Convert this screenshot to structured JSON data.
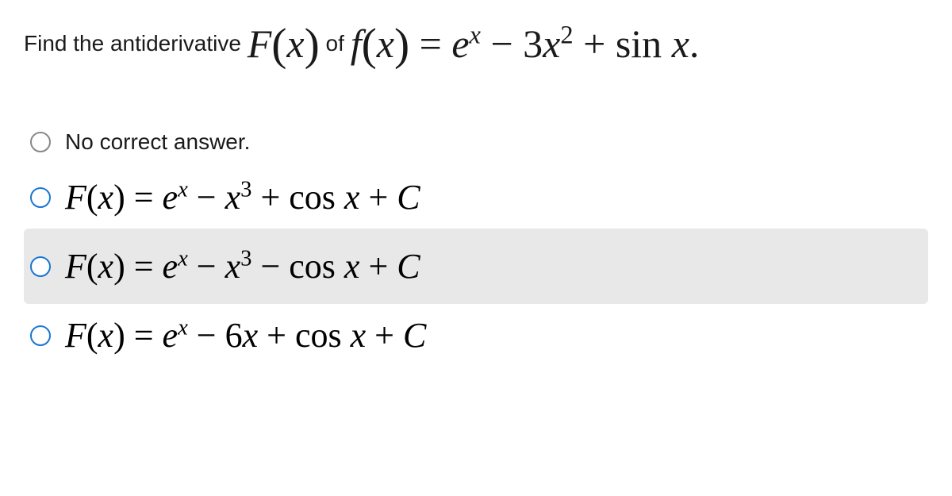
{
  "question": {
    "prefix": "Find the antiderivative ",
    "F_of_x": "F(x)",
    "middle": " of ",
    "f_of_x": "f(x) = e",
    "sup_x": "x",
    "minus": " − 3x",
    "sup_2": "2",
    "tail": " + sin x."
  },
  "options": [
    {
      "kind": "text",
      "label": "No correct answer.",
      "highlighted": false,
      "blue": false
    },
    {
      "kind": "math",
      "pre": "F(x) = e",
      "supA": "x",
      "mid": " − x",
      "supB": "3",
      "tail": " + cos x + C",
      "highlighted": false,
      "blue": true
    },
    {
      "kind": "math",
      "pre": "F(x) = e",
      "supA": "x",
      "mid": " − x",
      "supB": "3",
      "tail": " − cos x + C",
      "highlighted": true,
      "blue": true
    },
    {
      "kind": "math",
      "pre": "F(x) = e",
      "supA": "x",
      "mid": " − 6x + cos x + C",
      "supB": "",
      "tail": "",
      "highlighted": false,
      "blue": true
    }
  ]
}
